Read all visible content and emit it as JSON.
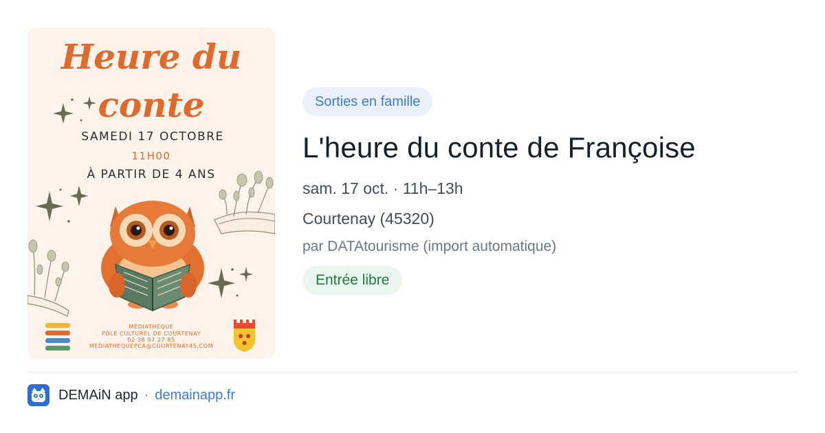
{
  "poster": {
    "title_line1": "Heure du",
    "title_line2": "conte",
    "date": "SAMEDI 17 OCTOBRE",
    "time": "11H00",
    "age": "À PARTIR DE 4 ANS",
    "venue_line1": "MÉDIATHÈQUE",
    "venue_line2": "PÔLE CULTUREL DE COURTENAY",
    "phone": "02 38 97 27 85",
    "email": "MEDIATHEQUEPCA@COURTENAY45.COM"
  },
  "event": {
    "category": "Sorties en famille",
    "title": "L'heure du conte de Françoise",
    "datetime": "sam. 17 oct. · 11h–13h",
    "location": "Courtenay (45320)",
    "source": "par DATAtourisme (import automatique)",
    "price": "Entrée libre"
  },
  "footer": {
    "app_name": "DEMAiN app",
    "separator": "·",
    "url": "demainapp.fr"
  },
  "colors": {
    "category_bg": "#eaf1fc",
    "category_text": "#3d7bd1",
    "price_bg": "#eaf7ee",
    "price_text": "#1f7a3d",
    "poster_orange": "#e06a2b",
    "title_text": "#15202e"
  },
  "icons": {
    "app_logo": "demain-app-logo-icon"
  }
}
